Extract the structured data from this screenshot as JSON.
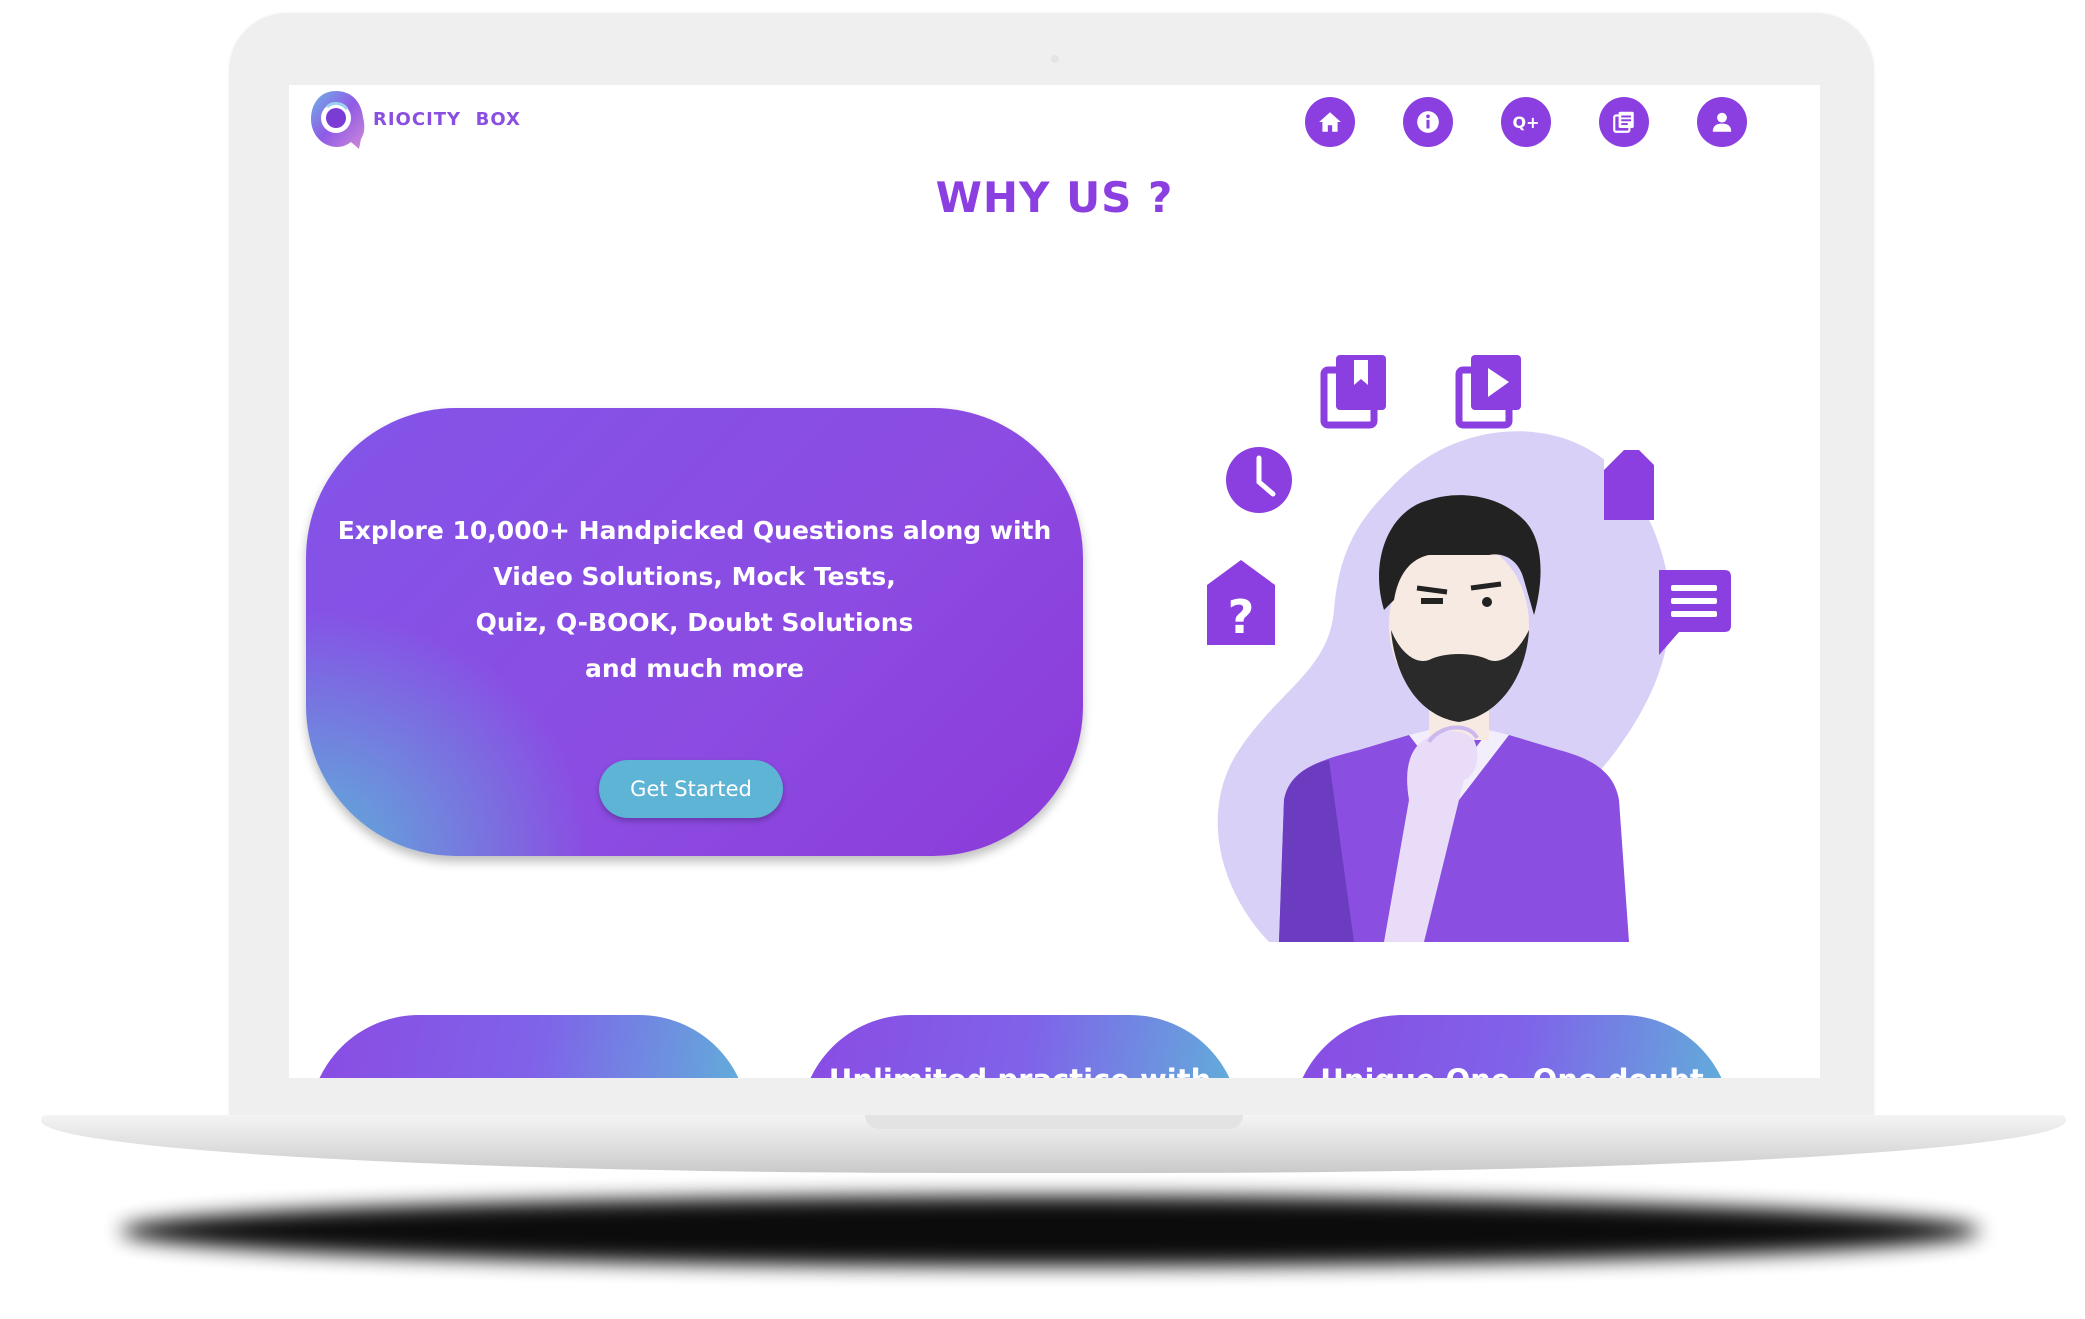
{
  "brand": {
    "name": "RIOCITY  BOX",
    "color": "#8b3fe0"
  },
  "nav": [
    {
      "id": "home",
      "icon": "home-icon"
    },
    {
      "id": "info",
      "icon": "info-icon"
    },
    {
      "id": "quiz",
      "icon": "q-plus-icon",
      "glyph": "Q+"
    },
    {
      "id": "book",
      "icon": "book-icon"
    },
    {
      "id": "profile",
      "icon": "user-icon"
    }
  ],
  "page": {
    "title": "WHY US ?"
  },
  "hero": {
    "lines": [
      "Explore 10,000+ Handpicked Questions along with",
      "Video Solutions, Mock Tests,",
      "Quiz, Q-BOOK, Doubt Solutions",
      "and much more"
    ],
    "cta_label": "Get Started",
    "gradient_start": "#8354e8",
    "gradient_end": "#8c3ad9",
    "accent": "#5db4d4"
  },
  "illustration": {
    "icons": [
      "library-bookmark-icon",
      "video-library-icon",
      "document-icon",
      "clock-icon",
      "question-home-icon",
      "chat-message-icon"
    ]
  },
  "features": [
    {
      "label": ""
    },
    {
      "label": "Unlimited practice with"
    },
    {
      "label": "Unique One- One doubt"
    }
  ]
}
